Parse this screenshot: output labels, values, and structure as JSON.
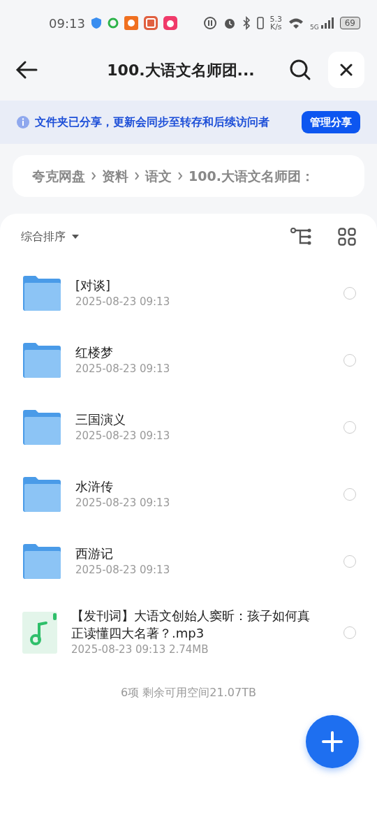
{
  "status_bar": {
    "time": "09:13",
    "net_speed_value": "5.3",
    "net_speed_unit": "K/s",
    "network": "5G",
    "battery": "69"
  },
  "header": {
    "title": "100.大语文名师团..."
  },
  "share_banner": {
    "text": "文件夹已分享，更新会同步至转存和后续访问者",
    "button": "管理分享"
  },
  "breadcrumb": [
    "夸克网盘",
    "资料",
    "语文",
    "100.大语文名师团："
  ],
  "toolbar": {
    "sort": "综合排序"
  },
  "files": [
    {
      "kind": "folder",
      "name": "[对谈]",
      "meta": "2025-08-23 09:13",
      "selected": false
    },
    {
      "kind": "folder",
      "name": "红楼梦",
      "meta": "2025-08-23 09:13",
      "selected": false
    },
    {
      "kind": "folder",
      "name": "三国演义",
      "meta": "2025-08-23 09:13",
      "selected": false
    },
    {
      "kind": "folder",
      "name": "水浒传",
      "meta": "2025-08-23 09:13",
      "selected": false
    },
    {
      "kind": "folder",
      "name": "西游记",
      "meta": "2025-08-23 09:13",
      "selected": false
    },
    {
      "kind": "audio",
      "name": "【发刊词】大语文创始人窦昕：孩子如何真正读懂四大名著？.mp3",
      "meta": "2025-08-23 09:13  2.74MB",
      "selected": false
    }
  ],
  "footer": {
    "summary": "6项 剩余可用空间21.07TB"
  }
}
